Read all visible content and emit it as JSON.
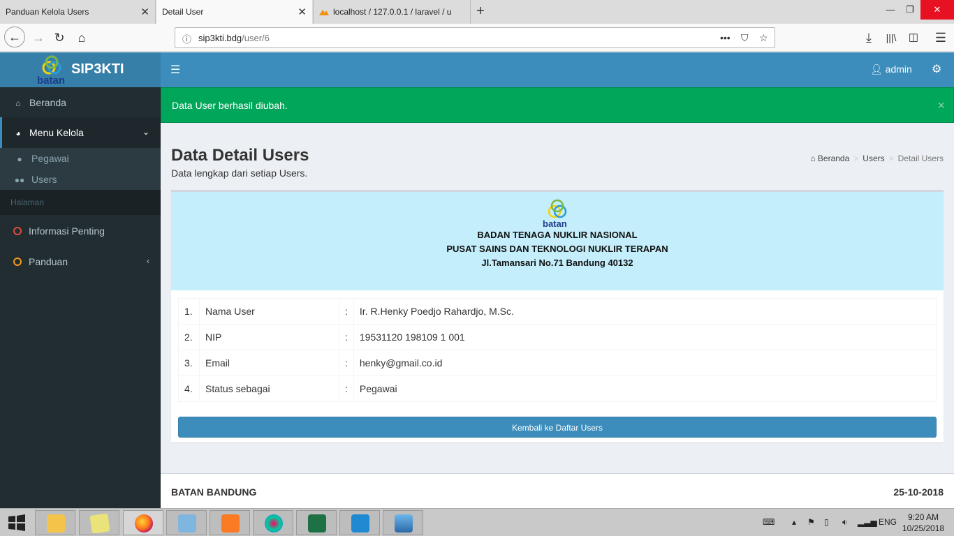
{
  "browser": {
    "tabs": [
      {
        "title": "Panduan Kelola Users",
        "active": false
      },
      {
        "title": "Detail User",
        "active": true
      },
      {
        "title": "localhost / 127.0.0.1 / laravel / u",
        "active": false
      }
    ],
    "url_host": "sip3kti.bdg",
    "url_path": "/user/6"
  },
  "app": {
    "brand": "SIP3KTI",
    "logo_text": "batan",
    "user": "admin"
  },
  "sidebar": {
    "items": [
      {
        "label": "Beranda",
        "icon": "home-icon"
      },
      {
        "label": "Menu Kelola",
        "icon": "dashboard-icon"
      },
      {
        "label": "Informasi Penting",
        "icon": "circle-icon"
      },
      {
        "label": "Panduan",
        "icon": "circle-icon"
      }
    ],
    "subitems": [
      {
        "label": "Pegawai",
        "icon": "user-icon"
      },
      {
        "label": "Users",
        "icon": "users-icon"
      }
    ],
    "header": "Halaman"
  },
  "alert": {
    "message": "Data User berhasil diubah.",
    "close": "×"
  },
  "page": {
    "title": "Data Detail Users",
    "subtitle": "Data lengkap dari setiap Users.",
    "breadcrumb": [
      "Beranda",
      "Users",
      "Detail Users"
    ]
  },
  "letterhead": {
    "logo_text": "batan",
    "line1": "BADAN TENAGA NUKLIR NASIONAL",
    "line2": "PUSAT SAINS DAN TEKNOLOGI NUKLIR TERAPAN",
    "line3": "Jl.Tamansari No.71 Bandung 40132"
  },
  "details": [
    {
      "no": "1.",
      "label": "Nama User",
      "sep": ":",
      "value": "Ir. R.Henky Poedjo Rahardjo, M.Sc."
    },
    {
      "no": "2.",
      "label": "NIP",
      "sep": ":",
      "value": "19531120 198109 1 001"
    },
    {
      "no": "3.",
      "label": "Email",
      "sep": ":",
      "value": "henky@gmail.co.id"
    },
    {
      "no": "4.",
      "label": "Status sebagai",
      "sep": ":",
      "value": "Pegawai"
    }
  ],
  "back_button": "Kembali ke Daftar Users",
  "footer": {
    "left": "BATAN BANDUNG",
    "right": "25-10-2018"
  },
  "taskbar": {
    "lang": "ENG",
    "time": "9:20 AM",
    "date": "10/25/2018"
  },
  "colors": {
    "primary": "#3c8dbc",
    "primary_dark": "#367fa9",
    "sidebar": "#222d32",
    "success": "#00a65a",
    "letterhead_bg": "#c4eefb"
  }
}
